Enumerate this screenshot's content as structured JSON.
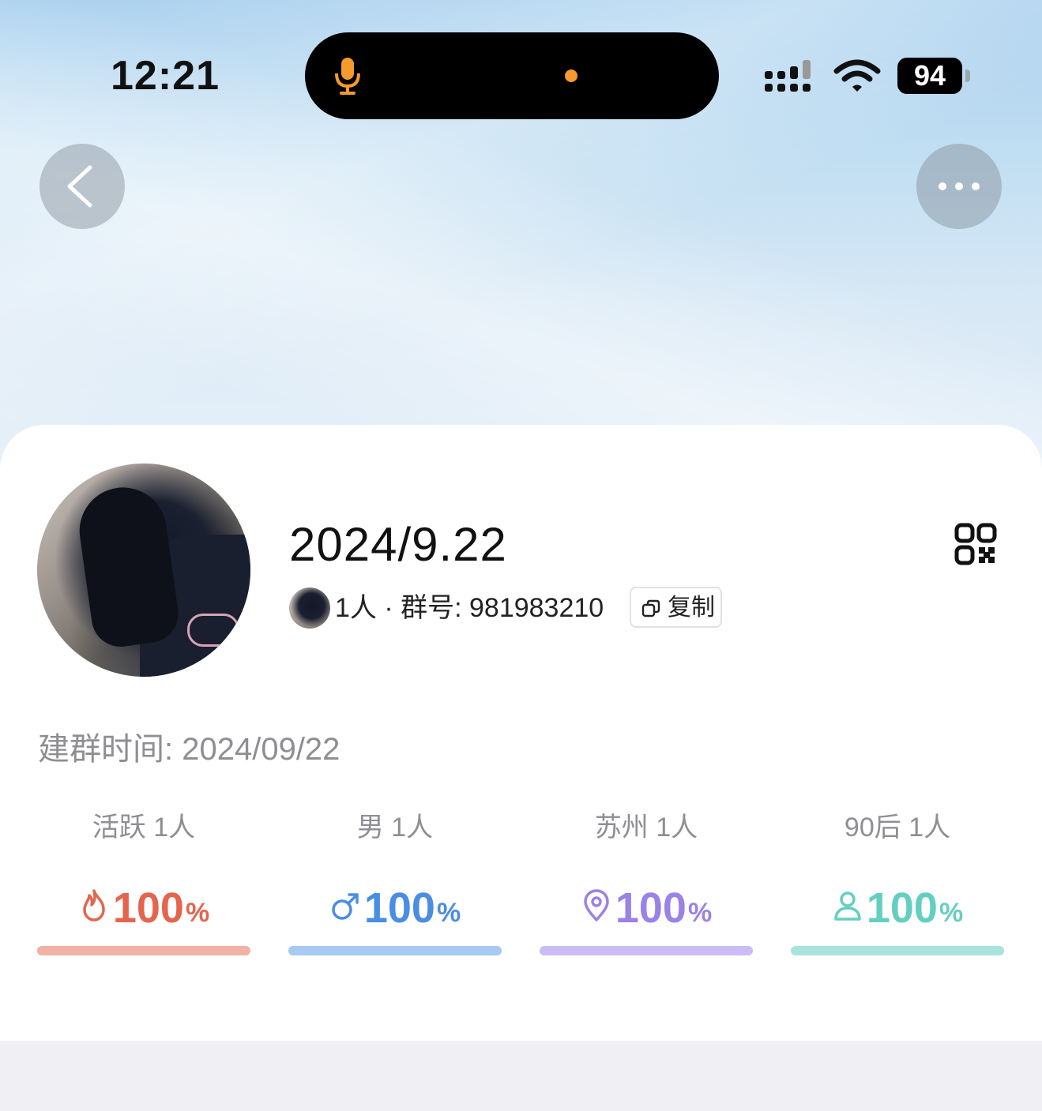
{
  "status_bar": {
    "time": "12:21",
    "battery": "94",
    "icons": [
      "mic-icon",
      "signal-icon",
      "wifi-icon",
      "battery-icon"
    ],
    "indicator_color": "#f59a2c"
  },
  "nav": {
    "back_icon": "chevron-left-icon",
    "more_icon": "more-dots-icon"
  },
  "group": {
    "title": "2024/9.22",
    "meta": "1人 · 群号: 981983210",
    "copy_label": "复制",
    "qr_icon": "qr-code-icon",
    "created": "建群时间: 2024/09/22"
  },
  "stats": [
    {
      "label": "活跃 1人",
      "value": "100",
      "unit": "%",
      "percent": 100,
      "icon": "flame-icon",
      "color": "#e4654d",
      "bar_color": "#f0b2a4"
    },
    {
      "label": "男 1人",
      "value": "100",
      "unit": "%",
      "percent": 100,
      "icon": "male-icon",
      "color": "#4a8ee3",
      "bar_color": "#a7c9f2"
    },
    {
      "label": "苏州 1人",
      "value": "100",
      "unit": "%",
      "percent": 100,
      "icon": "location-pin-icon",
      "color": "#9a82e8",
      "bar_color": "#c9bdf3"
    },
    {
      "label": "90后 1人",
      "value": "100",
      "unit": "%",
      "percent": 100,
      "icon": "person-icon",
      "color": "#63cfc0",
      "bar_color": "#a8e4dc"
    }
  ]
}
